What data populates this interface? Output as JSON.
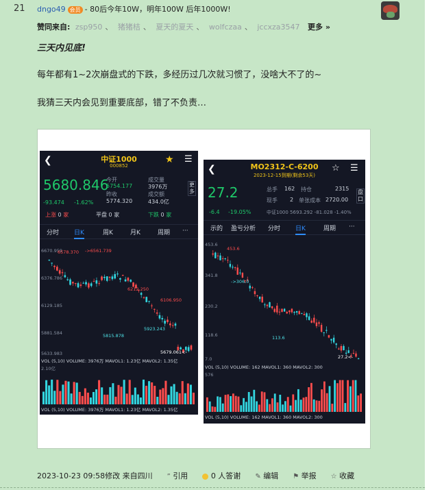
{
  "post": {
    "floor": "21",
    "author": "dngo49",
    "vip_badge": "会员",
    "tagline": "- 80后今年10W，明年100W   后年1000W!",
    "sources_label": "赞同来自:",
    "sources": [
      "zsp950",
      "猪猪桔",
      "夏天的夏天",
      "wolfczaa",
      "jccxza3547"
    ],
    "sources_sep": "、",
    "more_label": "更多 »",
    "title": "三天内见底!",
    "para1": "每年都有1~2次崩盘式的下跌，多经历过几次就习惯了，没啥大不了的~",
    "para2": "我猜三天内会见到重要底部，错了不负责…",
    "footer": {
      "time": "2023-10-23 09:58修改 来自四川",
      "quote": "引用",
      "thanks": "0 人答谢",
      "edit": "编辑",
      "report": "举报",
      "favorite": "收藏"
    }
  },
  "phone1": {
    "title": "中证1000",
    "code": "000852",
    "price": "5680.846",
    "change": "-93.474",
    "change_pct": "-1.62%",
    "stats": {
      "today_label": "今开",
      "today": "5754.177",
      "prev_label": "昨收",
      "prev": "5774.320",
      "vol_label": "成交量",
      "vol": "3976万",
      "amt_label": "成交额",
      "amt": "434.0亿"
    },
    "more": "更多",
    "updown": {
      "up_label": "上涨",
      "up": "0",
      "up_unit": "家",
      "flat_label": "平盘",
      "flat": "0",
      "flat_unit": "家",
      "down_label": "下跌",
      "down": "0",
      "down_unit": "家"
    },
    "tabs": [
      "分时",
      "日K",
      "周K",
      "月K",
      "周期",
      "···"
    ],
    "axis": [
      "6670.959",
      "6376.786",
      "6129.185",
      "5881.584",
      "5633.983"
    ],
    "annotations": [
      "6578.370",
      "->6561.739",
      "6212.250",
      "6106.950",
      "5815.878",
      "5923.243",
      "5679.061<-"
    ],
    "vol_line": "VOL  (5,10)  VOLUME: 3976万  MAVOL1: 1.23亿  MAVOL2: 1.35亿",
    "vol_axis": "2.10亿",
    "vol_line2": "VOL  (5,10)  VOLUME: 3976万  MAVOL1: 1.23亿  MAVOL2: 1.35亿"
  },
  "phone2": {
    "title": "MO2312-C-6200",
    "sub": "2023-12-15到期(剩余53天)",
    "price": "27.2",
    "change": "-6.4",
    "change_pct": "-19.05%",
    "stats": {
      "total_label": "总手",
      "total": "162",
      "hold_label": "持仓",
      "hold": "2315",
      "cur_label": "现手",
      "cur": "2",
      "cost_label": "单张成本",
      "cost": "2720.00"
    },
    "index_line": "中证1000   5693.292  -81.028  -1.40%",
    "side": "盘口",
    "tabs": [
      "示的",
      "盈亏分析",
      "分时",
      "日K",
      "周期",
      "···"
    ],
    "axis": [
      "453.6",
      "341.8",
      "230.2",
      "118.6",
      "7.0"
    ],
    "annotations": [
      "453.6",
      "->306.0",
      "113.6",
      "27.2<-"
    ],
    "vol_line": "VOL  (5,10)  VOLUME: 162  MAVOL1: 360  MAVOL2: 300",
    "vol_axis": "576",
    "vol_line2": "VOL  (5,10)  VOLUME: 162  MAVOL1: 360  MAVOL2: 300"
  }
}
